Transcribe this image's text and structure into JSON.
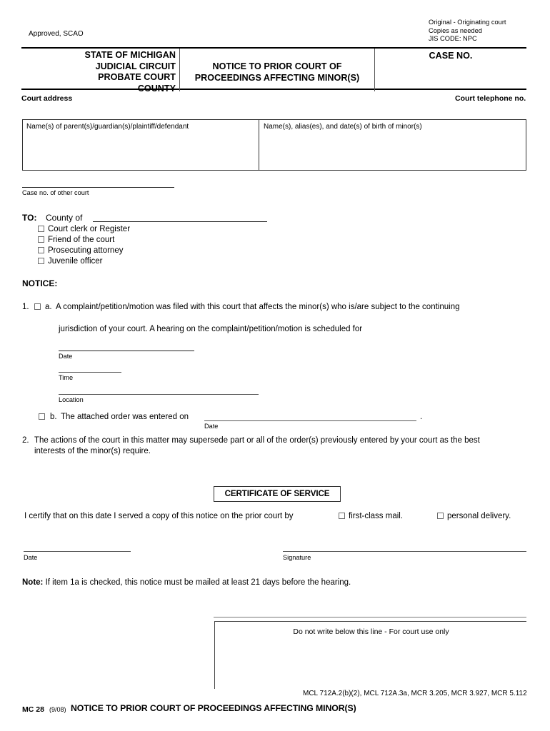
{
  "document": {
    "approved_by": "Approved, SCAO",
    "distribution": [
      "Original - Originating court",
      "Copies as needed",
      "JIS CODE: NPC"
    ]
  },
  "header": {
    "state_lines": [
      "STATE OF MICHIGAN",
      "JUDICIAL CIRCUIT",
      "PROBATE COURT",
      "COUNTY"
    ],
    "form_title_line1": "NOTICE TO PRIOR COURT OF",
    "form_title_line2": "PROCEEDINGS AFFECTING MINOR(S)",
    "case_no_label": "CASE NO.",
    "court_address_label": "Court address",
    "court_telephone_label": "Court telephone no."
  },
  "parties": {
    "left_label": "Name(s) of parent(s)/guardian(s)/plaintiff/defendant",
    "right_label": "Name(s), alias(es), and date(s) of birth of minor(s)"
  },
  "other_court": {
    "case_no_label": "Case no. of other court"
  },
  "to_section": {
    "to_label": "TO:",
    "county_of_label": "County of",
    "recipients": [
      "Court clerk or Register",
      "Friend of the court",
      "Prosecuting attorney",
      "Juvenile officer"
    ]
  },
  "notice": {
    "heading": "NOTICE:",
    "item1_number": "1.",
    "item1a_letter": "a.",
    "item1a_text_line1": "A complaint/petition/motion was filed with this court that affects the minor(s) who is/are subject to the continuing",
    "item1a_text_line2": "jurisdiction of your court.  A hearing on the complaint/petition/motion is scheduled for",
    "date_caption": "Date",
    "time_caption": "Time",
    "location_caption": "Location",
    "item1b_letter": "b.",
    "item1b_text": "The attached order was entered on",
    "item1b_date_caption": "Date",
    "item1b_period": ".",
    "item2_number": "2.",
    "item2_text_line1": "The actions of the court in this matter may supersede part or all of the order(s) previously entered by your court as the best",
    "item2_text_line2": "interests of the minor(s) require."
  },
  "certificate": {
    "heading": "CERTIFICATE OF SERVICE",
    "certify_text": "I certify that on this date I served a copy of this notice on the prior court by",
    "option_mail": "first-class mail.",
    "option_personal": "personal delivery.",
    "date_caption": "Date",
    "signature_caption": "Signature"
  },
  "note": {
    "label": "Note:",
    "text": "If item 1a is checked, this notice must be mailed at least 21 days before the hearing."
  },
  "court_use": {
    "label": "Do not write below this line - For court use only"
  },
  "footer": {
    "citations": "MCL 712A.2(b)(2), MCL 712A.3a, MCR 3.205, MCR 3.927, MCR 5.112",
    "form_number": "MC 28",
    "form_revision": "(9/08)",
    "form_title": "NOTICE TO PRIOR COURT OF PROCEEDINGS AFFECTING MINOR(S)"
  }
}
